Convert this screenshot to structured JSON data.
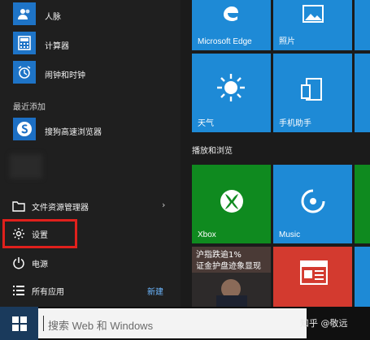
{
  "start_menu": {
    "apps": [
      {
        "label": "人脉",
        "icon": "people-icon"
      },
      {
        "label": "计算器",
        "icon": "calculator-icon"
      },
      {
        "label": "闹钟和时钟",
        "icon": "alarm-clock-icon"
      }
    ],
    "recent_section": {
      "title": "最近添加",
      "items": [
        {
          "label": "搜狗高速浏览器",
          "icon": "sogou-browser-icon"
        }
      ]
    },
    "system_items": {
      "file_explorer": "文件资源管理器",
      "settings": "设置",
      "power": "电源",
      "all_apps": "所有应用",
      "new_badge": "新建"
    }
  },
  "tiles": {
    "edge": "Microsoft Edge",
    "photos": "照片",
    "weather": "天气",
    "phone_companion": "手机助手",
    "group_title": "播放和浏览",
    "xbox": "Xbox",
    "music": "Music",
    "news_headline": "沪指跌逾1%\n证金护盘迹象显现"
  },
  "taskbar": {
    "search_placeholder": "搜索 Web 和 Windows",
    "watermark": "知乎 @敬远"
  },
  "colors": {
    "tile_blue": "#1e8ad6",
    "tile_green": "#0f8a1f",
    "tile_red": "#d33a2f",
    "highlight": "#e0201c",
    "accent_link": "#6cb7ff"
  }
}
